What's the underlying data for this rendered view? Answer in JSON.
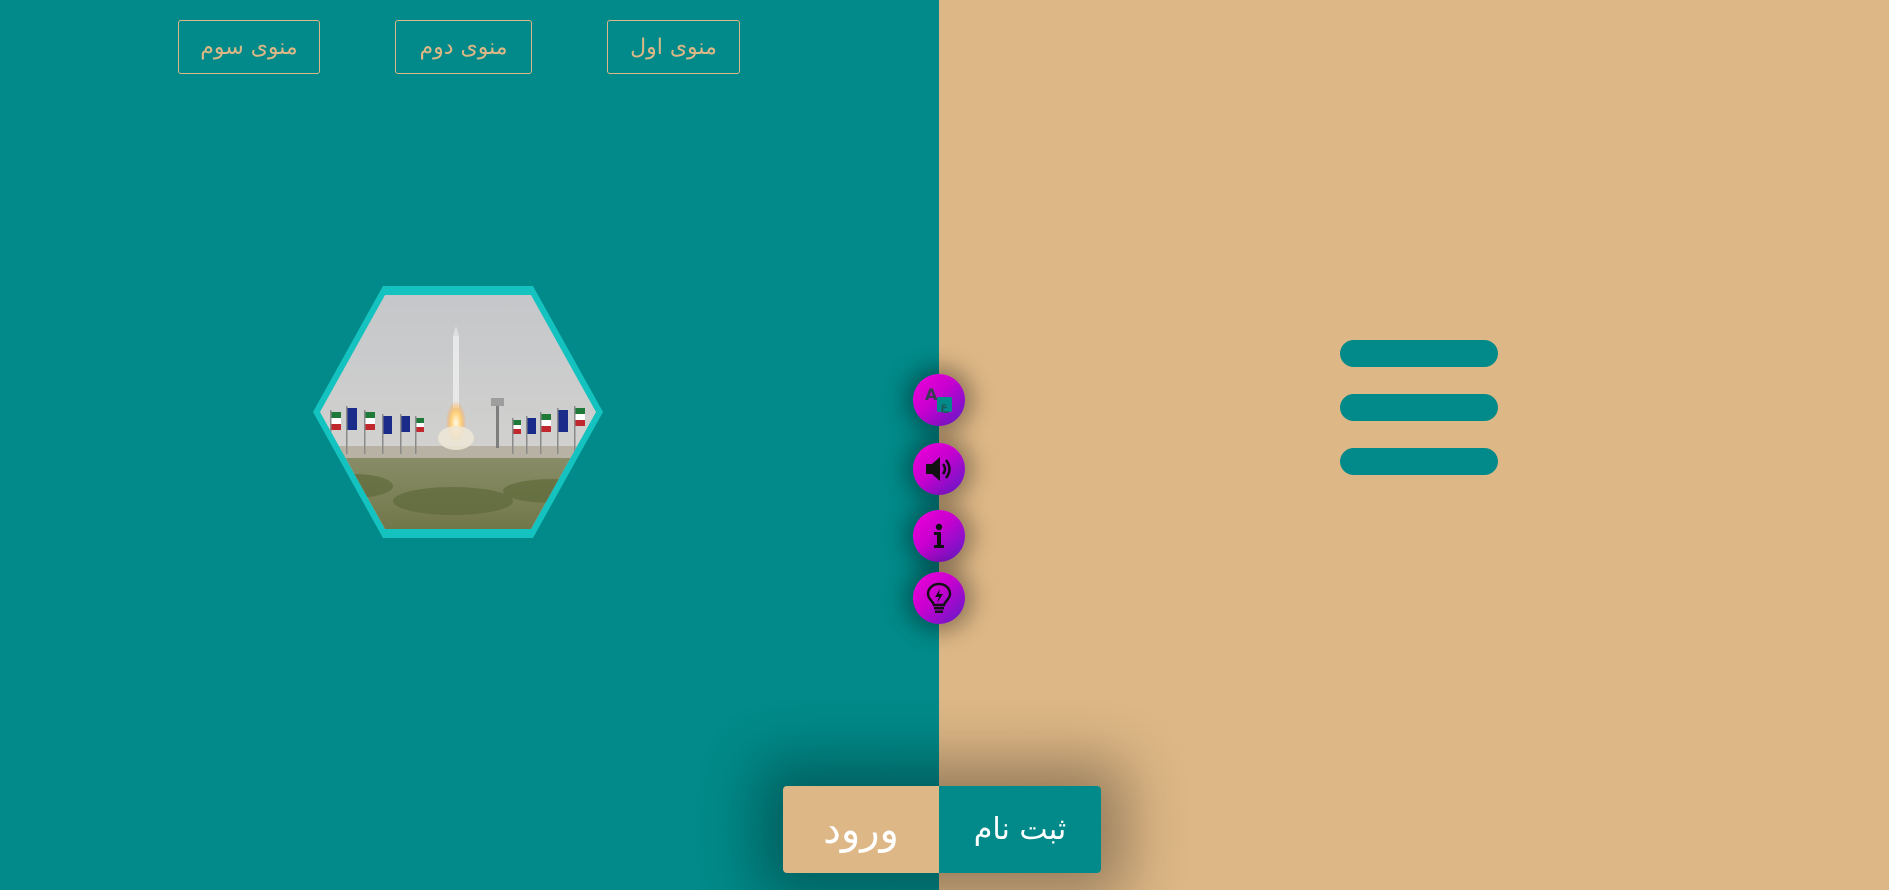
{
  "top_menu": {
    "first": "منوی اول",
    "second": "منوی دوم",
    "third": "منوی سوم"
  },
  "auth": {
    "login_label": "ورود",
    "register_label": "ثبت نام"
  },
  "floating_buttons": [
    {
      "icon": "translate-icon"
    },
    {
      "icon": "speaker-icon"
    },
    {
      "icon": "info-icon"
    },
    {
      "icon": "lightbulb-icon"
    }
  ],
  "colors": {
    "teal": "#018a89",
    "sand": "#ddb786",
    "hex_border": "#14c2bf",
    "fab_magenta": "#f000d8",
    "fab_purple": "#5b1cc4"
  }
}
